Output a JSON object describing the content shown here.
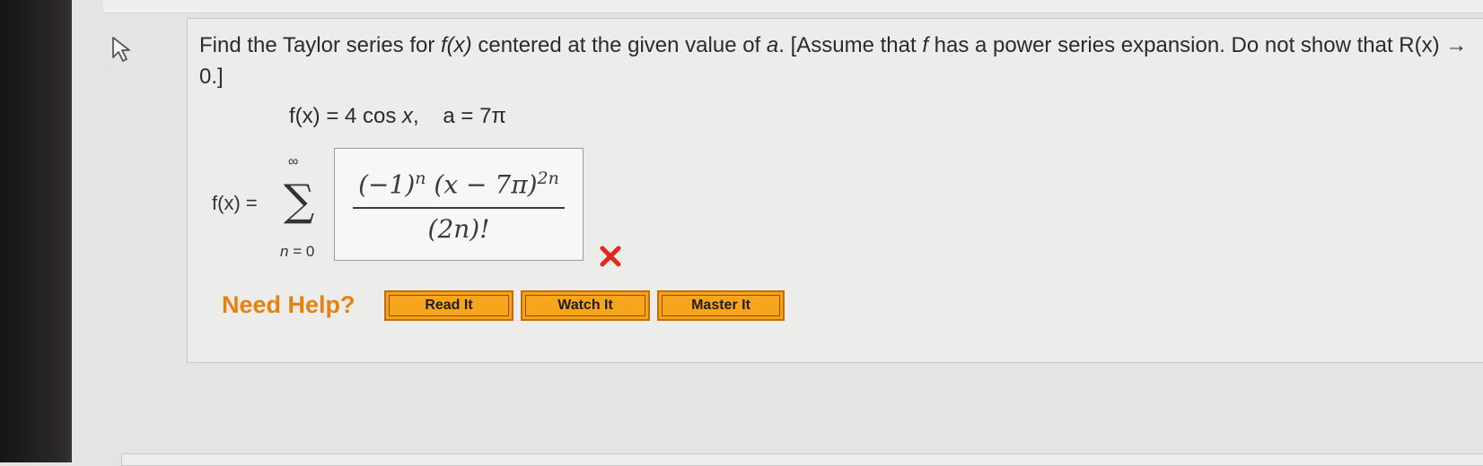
{
  "question": {
    "prefix": "Find the Taylor series for ",
    "fx": "f(x)",
    "middle": " centered at the given value of ",
    "a": "a",
    "bracket_open": ". [Assume that ",
    "f": "f",
    "rest": " has a power series expansion. Do not show that R(x) → 0.]"
  },
  "function_def": {
    "f_lhs": "f(x) = 4 cos ",
    "f_var": "x",
    "sep": ",    a = 7π"
  },
  "series": {
    "lhs": "f(x) =",
    "upper_limit": "∞",
    "sigma": "∑",
    "lower_var": "n",
    "lower_rest": " = 0"
  },
  "answer": {
    "numerator": "(−1)",
    "num_exp1": "n",
    "numerator_mid": " (x − 7π)",
    "num_exp2": "2n",
    "denominator": "(2n)!",
    "status": "incorrect"
  },
  "help": {
    "label": "Need Help?",
    "buttons": [
      "Read It",
      "Watch It",
      "Master It"
    ]
  },
  "colors": {
    "accent": "#e5820e",
    "button_bg": "#f4a31a",
    "error": "#e0291e"
  },
  "icons": {
    "cursor": "pointer-cursor-icon",
    "wrong": "x-mark-icon"
  }
}
